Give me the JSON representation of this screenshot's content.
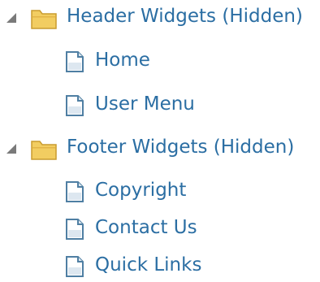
{
  "tree": {
    "groups": [
      {
        "label": "Header Widgets (Hidden)",
        "expanded": true,
        "icon": "folder-icon",
        "items": [
          {
            "label": "Home",
            "icon": "page-icon"
          },
          {
            "label": "User Menu",
            "icon": "page-icon"
          }
        ]
      },
      {
        "label": "Footer Widgets (Hidden)",
        "expanded": true,
        "icon": "folder-icon",
        "items": [
          {
            "label": "Copyright",
            "icon": "page-icon"
          },
          {
            "label": "Contact Us",
            "icon": "page-icon"
          },
          {
            "label": "Quick Links",
            "icon": "page-icon"
          }
        ]
      }
    ]
  },
  "colors": {
    "label_text": "#2b6ea3",
    "folder_fill": "#f2cd61",
    "folder_stroke": "#c99b2f",
    "page_stroke": "#4f7fa3",
    "expander": "#7a7a7a"
  }
}
